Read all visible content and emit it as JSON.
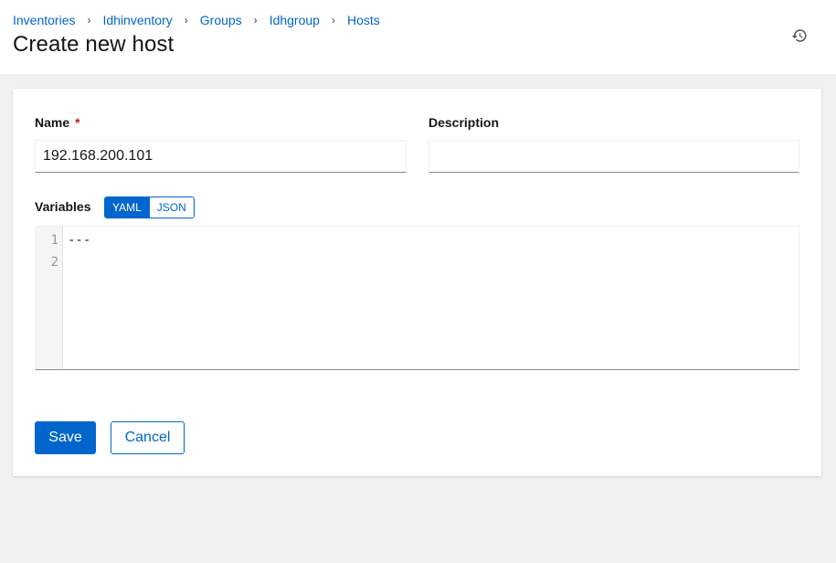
{
  "breadcrumb": [
    {
      "label": "Inventories"
    },
    {
      "label": "Idhinventory"
    },
    {
      "label": "Groups"
    },
    {
      "label": "Idhgroup"
    },
    {
      "label": "Hosts"
    }
  ],
  "page_title": "Create new host",
  "icons": {
    "history": "history-icon",
    "separator": "chevron-right-icon"
  },
  "form": {
    "name_label": "Name",
    "required_marker": "*",
    "name_value": "192.168.200.101",
    "description_label": "Description",
    "description_value": "",
    "variables_label": "Variables",
    "toggle_yaml": "YAML",
    "toggle_json": "JSON",
    "toggle_selected": "YAML",
    "editor_lines": [
      {
        "number": "1",
        "text": "---"
      },
      {
        "number": "2",
        "text": ""
      }
    ]
  },
  "actions": {
    "save": "Save",
    "cancel": "Cancel"
  },
  "colors": {
    "accent": "#0066cc",
    "required": "#c9190b",
    "background": "#f0f0f0"
  }
}
